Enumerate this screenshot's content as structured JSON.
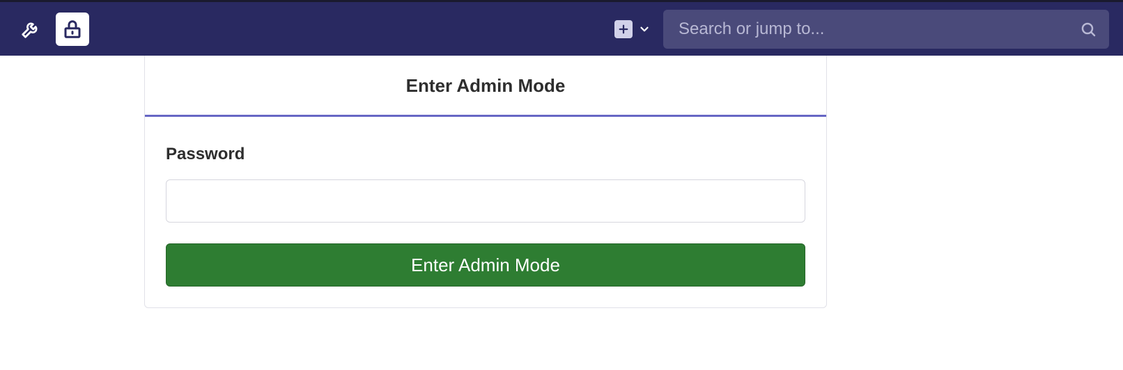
{
  "topbar": {
    "search_placeholder": "Search or jump to..."
  },
  "panel": {
    "title": "Enter Admin Mode",
    "password_label": "Password",
    "password_value": "",
    "submit_label": "Enter Admin Mode"
  }
}
